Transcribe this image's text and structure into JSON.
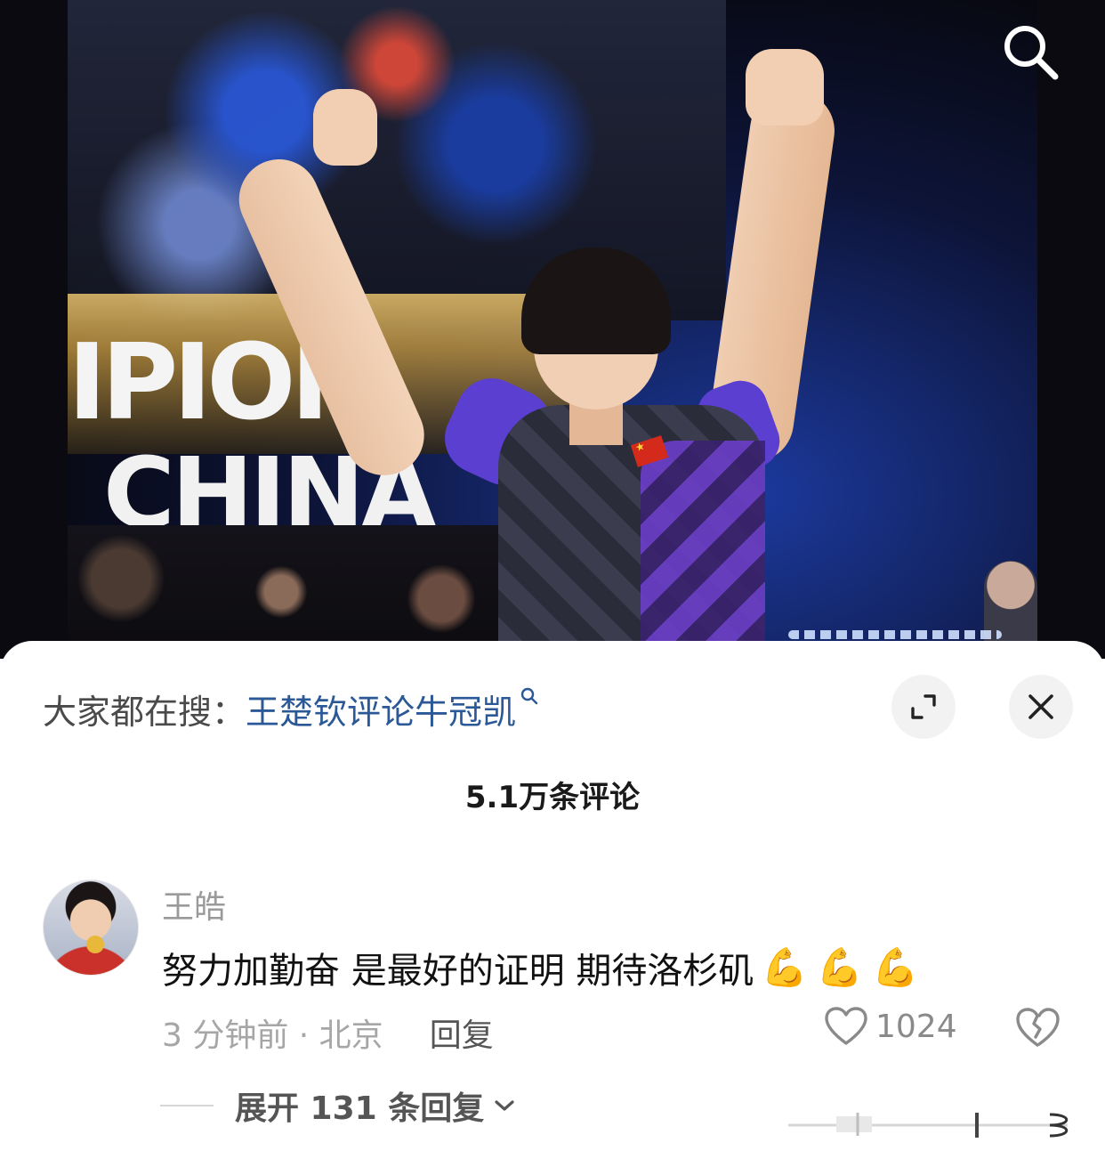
{
  "photo": {
    "banner_line_1": "IPIOI",
    "banner_line_2": "CHINA"
  },
  "header": {
    "search_icon": "search-icon"
  },
  "sheet": {
    "search_hint_prefix": "大家都在搜：",
    "search_hint_link": "王楚钦评论牛冠凯",
    "expand_icon": "expand-icon",
    "close_icon": "close-icon",
    "comment_count": "5.1万条评论"
  },
  "comment": {
    "username": "王皓",
    "text": "努力加勤奋 是最好的证明 期待洛杉矶",
    "emojis": [
      "💪",
      "💪",
      "💪"
    ],
    "time_location": "3 分钟前 · 北京",
    "reply_label": "回复",
    "like_count": "1024",
    "expand_replies_label": "展开 131 条回复"
  },
  "colors": {
    "link": "#2b5896",
    "muted": "#a6a6a6",
    "button_bg": "#f2f2f2"
  }
}
